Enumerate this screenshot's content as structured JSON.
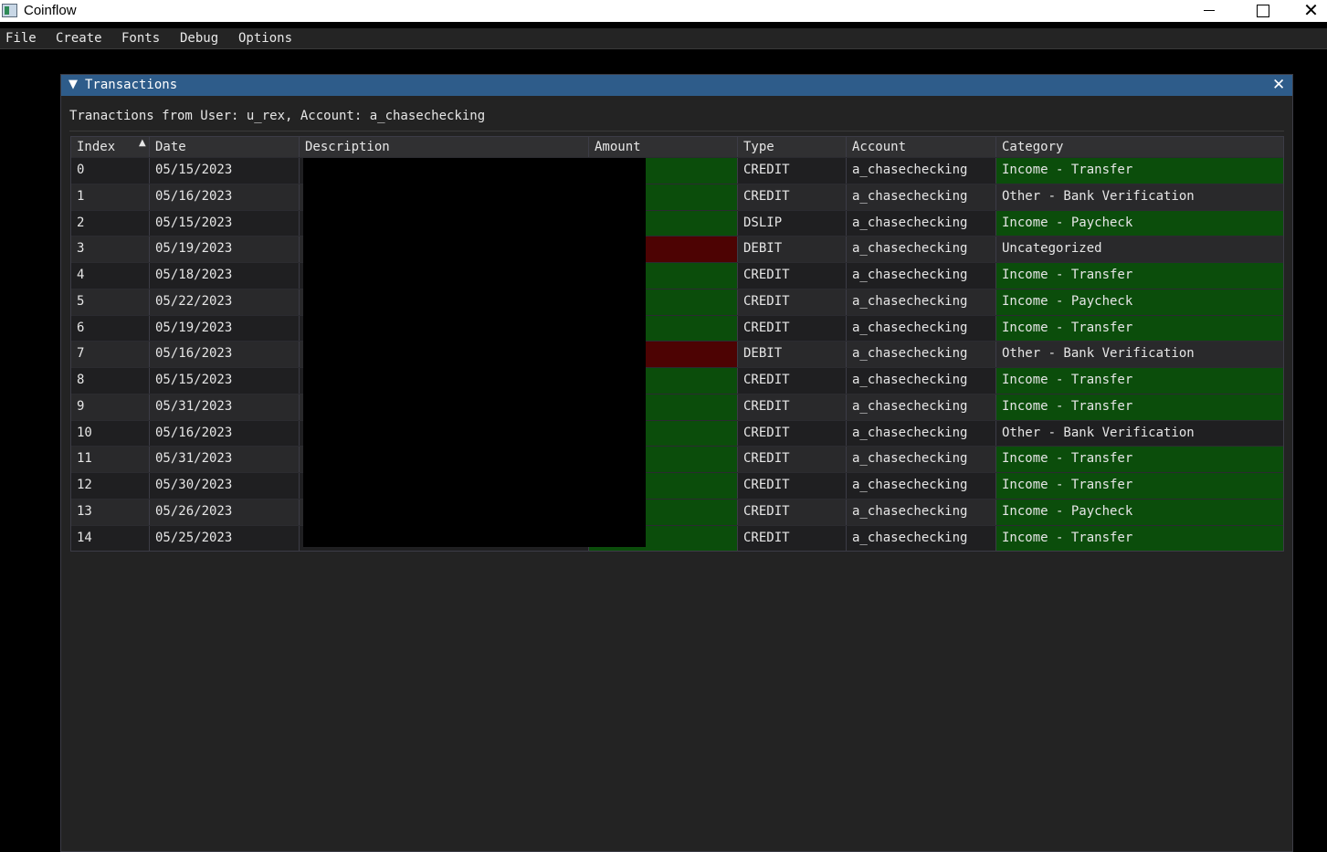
{
  "os_window": {
    "title": "Coinflow",
    "close_glyph": "✕"
  },
  "menubar": {
    "items": [
      "File",
      "Create",
      "Fonts",
      "Debug",
      "Options"
    ]
  },
  "window": {
    "title": "Transactions",
    "collapse_glyph": "▼",
    "close_glyph": "✕",
    "subtitle": "Tranactions from User: u_rex, Account: a_chasechecking"
  },
  "table": {
    "columns": [
      "Index",
      "Date",
      "Description",
      "Amount",
      "Type",
      "Account",
      "Category"
    ],
    "sort_column": "Index",
    "sort_glyph": "▲",
    "rows": [
      {
        "index": "0",
        "date": "05/15/2023",
        "type": "CREDIT",
        "account": "a_chasechecking",
        "category": "Income - Transfer"
      },
      {
        "index": "1",
        "date": "05/16/2023",
        "type": "CREDIT",
        "account": "a_chasechecking",
        "category": "Other - Bank Verification"
      },
      {
        "index": "2",
        "date": "05/15/2023",
        "type": "DSLIP",
        "account": "a_chasechecking",
        "category": "Income - Paycheck"
      },
      {
        "index": "3",
        "date": "05/19/2023",
        "type": "DEBIT",
        "account": "a_chasechecking",
        "category": "Uncategorized"
      },
      {
        "index": "4",
        "date": "05/18/2023",
        "type": "CREDIT",
        "account": "a_chasechecking",
        "category": "Income - Transfer"
      },
      {
        "index": "5",
        "date": "05/22/2023",
        "type": "CREDIT",
        "account": "a_chasechecking",
        "category": "Income - Paycheck"
      },
      {
        "index": "6",
        "date": "05/19/2023",
        "type": "CREDIT",
        "account": "a_chasechecking",
        "category": "Income - Transfer"
      },
      {
        "index": "7",
        "date": "05/16/2023",
        "type": "DEBIT",
        "account": "a_chasechecking",
        "category": "Other - Bank Verification"
      },
      {
        "index": "8",
        "date": "05/15/2023",
        "type": "CREDIT",
        "account": "a_chasechecking",
        "category": "Income - Transfer"
      },
      {
        "index": "9",
        "date": "05/31/2023",
        "type": "CREDIT",
        "account": "a_chasechecking",
        "category": "Income - Transfer"
      },
      {
        "index": "10",
        "date": "05/16/2023",
        "type": "CREDIT",
        "account": "a_chasechecking",
        "category": "Other - Bank Verification"
      },
      {
        "index": "11",
        "date": "05/31/2023",
        "type": "CREDIT",
        "account": "a_chasechecking",
        "category": "Income - Transfer"
      },
      {
        "index": "12",
        "date": "05/30/2023",
        "type": "CREDIT",
        "account": "a_chasechecking",
        "category": "Income - Transfer"
      },
      {
        "index": "13",
        "date": "05/26/2023",
        "type": "CREDIT",
        "account": "a_chasechecking",
        "category": "Income - Paycheck"
      },
      {
        "index": "14",
        "date": "05/25/2023",
        "type": "CREDIT",
        "account": "a_chasechecking",
        "category": "Income - Transfer"
      }
    ]
  },
  "colors": {
    "credit_cell": "#0b4d0b",
    "debit_cell": "#4d0303",
    "title_bar": "#2e5c8a",
    "window_bg": "#232323"
  }
}
